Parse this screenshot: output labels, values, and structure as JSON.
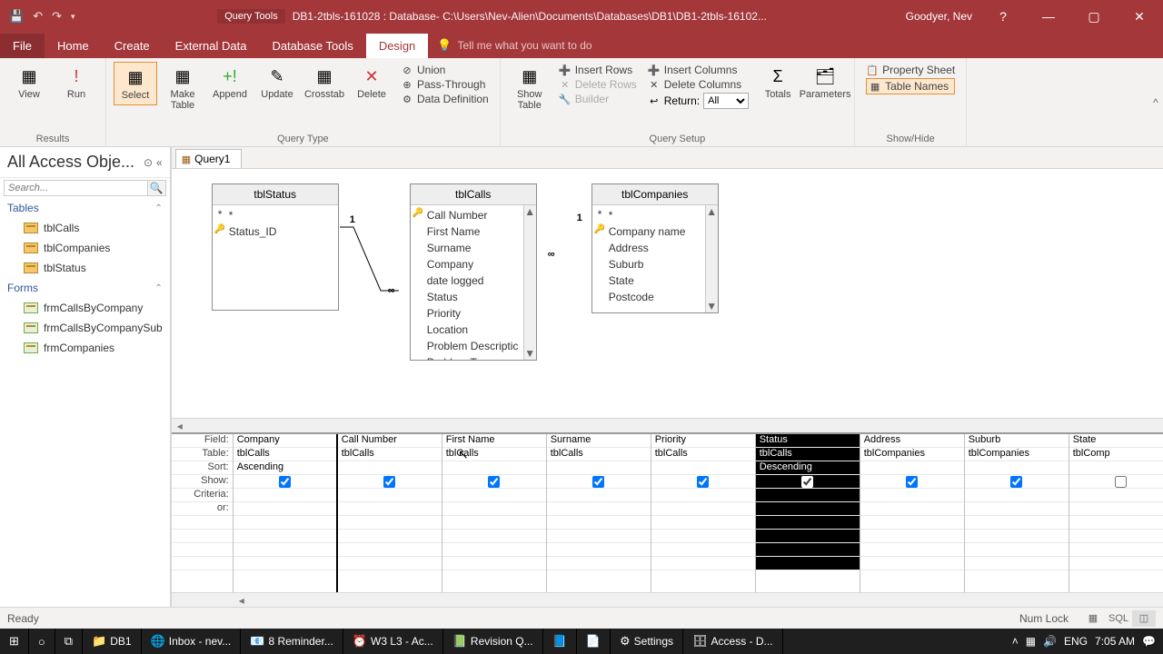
{
  "titlebar": {
    "tools_label": "Query Tools",
    "title": "DB1-2tbls-161028 : Database- C:\\Users\\Nev-Alien\\Documents\\Databases\\DB1\\DB1-2tbls-16102...",
    "user": "Goodyer, Nev"
  },
  "tabs": {
    "file": "File",
    "home": "Home",
    "create": "Create",
    "external": "External Data",
    "dbtools": "Database Tools",
    "design": "Design",
    "tell": "Tell me what you want to do"
  },
  "ribbon": {
    "results": {
      "view": "View",
      "run": "Run",
      "label": "Results"
    },
    "querytype": {
      "select": "Select",
      "make": "Make\nTable",
      "append": "Append",
      "update": "Update",
      "crosstab": "Crosstab",
      "delete": "Delete",
      "union": "Union",
      "passthrough": "Pass-Through",
      "datadef": "Data Definition",
      "label": "Query Type"
    },
    "setup": {
      "showtable": "Show\nTable",
      "insrows": "Insert Rows",
      "delrows": "Delete Rows",
      "builder": "Builder",
      "inscols": "Insert Columns",
      "delcols": "Delete Columns",
      "return": "Return:",
      "return_val": "All",
      "totals": "Totals",
      "params": "Parameters",
      "label": "Query Setup"
    },
    "showhide": {
      "prop": "Property Sheet",
      "tnames": "Table Names",
      "label": "Show/Hide"
    }
  },
  "nav": {
    "header": "All Access Obje...",
    "search_ph": "Search...",
    "groups": {
      "tables": "Tables",
      "forms": "Forms"
    },
    "tables": [
      "tblCalls",
      "tblCompanies",
      "tblStatus"
    ],
    "forms": [
      "frmCallsByCompany",
      "frmCallsByCompanySub",
      "frmCompanies"
    ]
  },
  "doc": {
    "tab": "Query1"
  },
  "diagram": {
    "tblStatus": {
      "title": "tblStatus",
      "fields": [
        "*",
        "Status_ID"
      ]
    },
    "tblCalls": {
      "title": "tblCalls",
      "fields": [
        "Call Number",
        "First Name",
        "Surname",
        "Company",
        "date logged",
        "Status",
        "Priority",
        "Location",
        "Problem Descriptic",
        "Problem Type"
      ]
    },
    "tblCompanies": {
      "title": "tblCompanies",
      "fields": [
        "*",
        "Company name",
        "Address",
        "Suburb",
        "State",
        "Postcode"
      ]
    }
  },
  "grid": {
    "labels": [
      "Field:",
      "Table:",
      "Sort:",
      "Show:",
      "Criteria:",
      "or:"
    ],
    "cols": [
      {
        "field": "Company",
        "table": "tblCalls",
        "sort": "Ascending",
        "show": true
      },
      {
        "field": "Call Number",
        "table": "tblCalls",
        "sort": "",
        "show": true
      },
      {
        "field": "First Name",
        "table": "tblCalls",
        "sort": "",
        "show": true
      },
      {
        "field": "Surname",
        "table": "tblCalls",
        "sort": "",
        "show": true
      },
      {
        "field": "Priority",
        "table": "tblCalls",
        "sort": "",
        "show": true
      },
      {
        "field": "Status",
        "table": "tblCalls",
        "sort": "Descending",
        "show": true,
        "selected": true
      },
      {
        "field": "Address",
        "table": "tblCompanies",
        "sort": "",
        "show": true
      },
      {
        "field": "Suburb",
        "table": "tblCompanies",
        "sort": "",
        "show": true
      },
      {
        "field": "State",
        "table": "tblComp",
        "sort": "",
        "show": false
      }
    ]
  },
  "status": {
    "ready": "Ready",
    "numlock": "Num Lock",
    "sql": "SQL"
  },
  "taskbar": {
    "items": [
      "DB1",
      "Inbox - nev...",
      "8 Reminder...",
      "W3 L3 - Ac...",
      "Revision Q...",
      " ",
      " ",
      "Settings",
      "Access - D..."
    ],
    "tray": {
      "lang": "ENG",
      "time": "7:05 AM"
    }
  }
}
